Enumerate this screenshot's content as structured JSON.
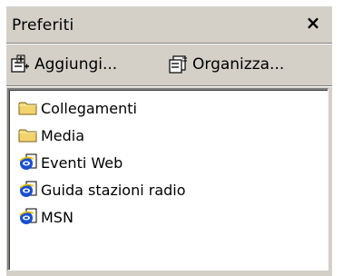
{
  "panel": {
    "title": "Preferiti",
    "close_label": "×"
  },
  "toolbar": {
    "add_label": "Aggiungi...",
    "organize_label": "Organizza..."
  },
  "favorites": [
    {
      "label": "Collegamenti",
      "icon": "folder-icon"
    },
    {
      "label": "Media",
      "icon": "folder-icon"
    },
    {
      "label": "Eventi Web",
      "icon": "ie-link-icon"
    },
    {
      "label": "Guida stazioni radio",
      "icon": "ie-link-icon"
    },
    {
      "label": "MSN",
      "icon": "ie-link-icon"
    }
  ],
  "colors": {
    "panel_bg": "#d4d0c8",
    "list_bg": "#ffffff",
    "folder": "#f3d36b",
    "ie_blue": "#1a4fd1"
  }
}
